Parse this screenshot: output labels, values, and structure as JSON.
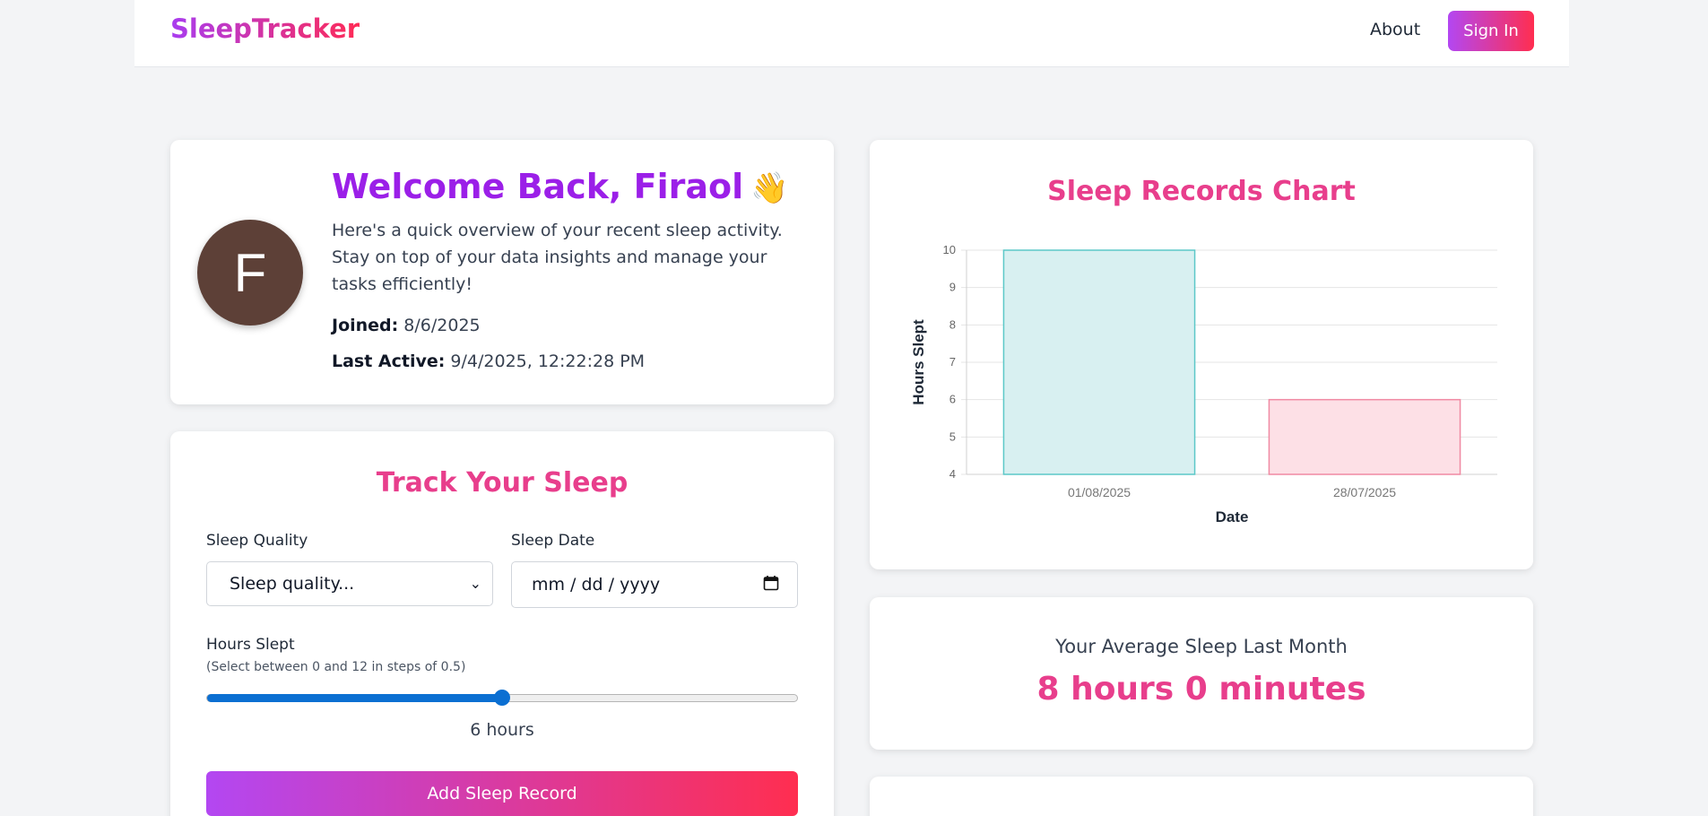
{
  "nav": {
    "logo": "SleepTracker",
    "about": "About",
    "sign_in": "Sign In"
  },
  "welcome": {
    "title": "Welcome Back, Firaol",
    "emoji": "👋",
    "avatar_letter": "F",
    "avatar_color": "#5d4037",
    "description": "Here's a quick overview of your recent sleep activity. Stay on top of your data insights and manage your tasks efficiently!",
    "joined_label": "Joined:",
    "joined_value": "8/6/2025",
    "last_active_label": "Last Active:",
    "last_active_value": "9/4/2025, 12:22:28 PM"
  },
  "track": {
    "title": "Track Your Sleep",
    "quality_label": "Sleep Quality",
    "quality_value": "Sleep quality...",
    "date_label": "Sleep Date",
    "date_placeholder": "mm / dd / yyyy",
    "hours_label": "Hours Slept",
    "hours_hint": "(Select between 0 and 12 in steps of 0.5)",
    "slider_min": 0,
    "slider_max": 12,
    "slider_value": 6,
    "hours_display": "6 hours",
    "submit": "Add Sleep Record"
  },
  "chart_title": "Sleep Records Chart",
  "chart_data": {
    "type": "bar",
    "categories": [
      "01/08/2025",
      "28/07/2025"
    ],
    "values": [
      10,
      6
    ],
    "colors": [
      "#d8f0f1",
      "#fde0e6"
    ],
    "border_colors": [
      "#5cc8c8",
      "#f08aa3"
    ],
    "xlabel": "Date",
    "ylabel": "Hours Slept",
    "ylim": [
      4,
      10
    ],
    "yticks": [
      4,
      5,
      6,
      7,
      8,
      9,
      10
    ],
    "grid": true
  },
  "average": {
    "label": "Your Average Sleep Last Month",
    "value": "8 hours 0 minutes"
  },
  "colors": {
    "accent_pink": "#e83e8c",
    "accent_purple": "#9b1fe8",
    "gradient_start": "#b347f2",
    "gradient_end": "#ff2e50",
    "slider_blue": "#0b6fd2"
  }
}
